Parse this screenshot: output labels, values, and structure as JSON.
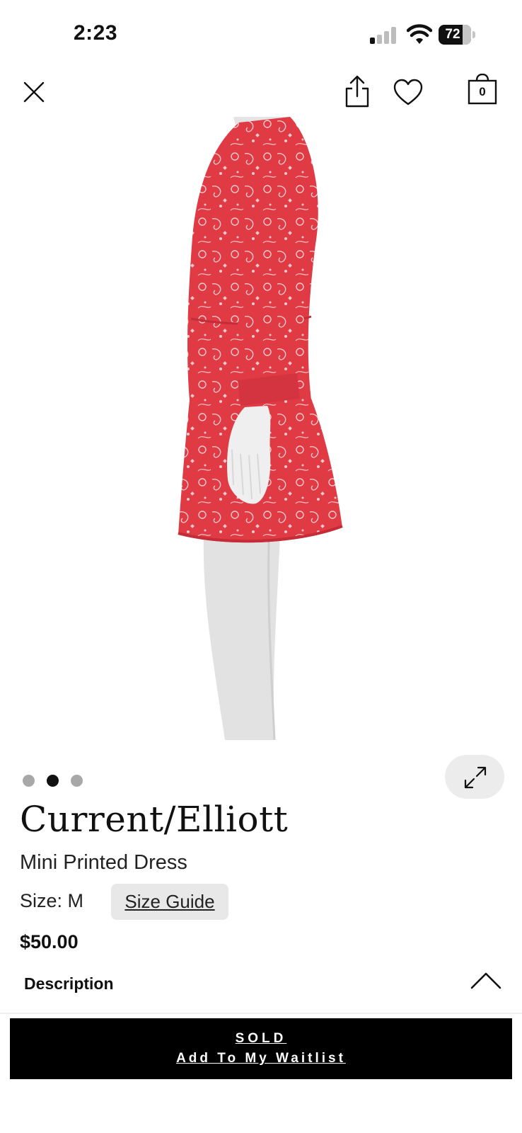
{
  "status_bar": {
    "time": "2:23",
    "battery": "72"
  },
  "nav": {
    "bag_count": "0",
    "icons": [
      "close-icon",
      "share-icon",
      "heart-icon",
      "shopping-bag-icon"
    ]
  },
  "carousel": {
    "total": 3,
    "active_index": 1
  },
  "product": {
    "brand": "Current/Elliott",
    "name": "Mini Printed Dress",
    "size_text": "Size: M",
    "size_guide_label": "Size Guide",
    "price": "$50.00",
    "image_colors": {
      "dress": "#e03a45",
      "mannequin": "#e2e2e2"
    }
  },
  "description": {
    "label": "Description"
  },
  "cta": {
    "line1": "SOLD",
    "line2": "Add To My Waitlist"
  }
}
